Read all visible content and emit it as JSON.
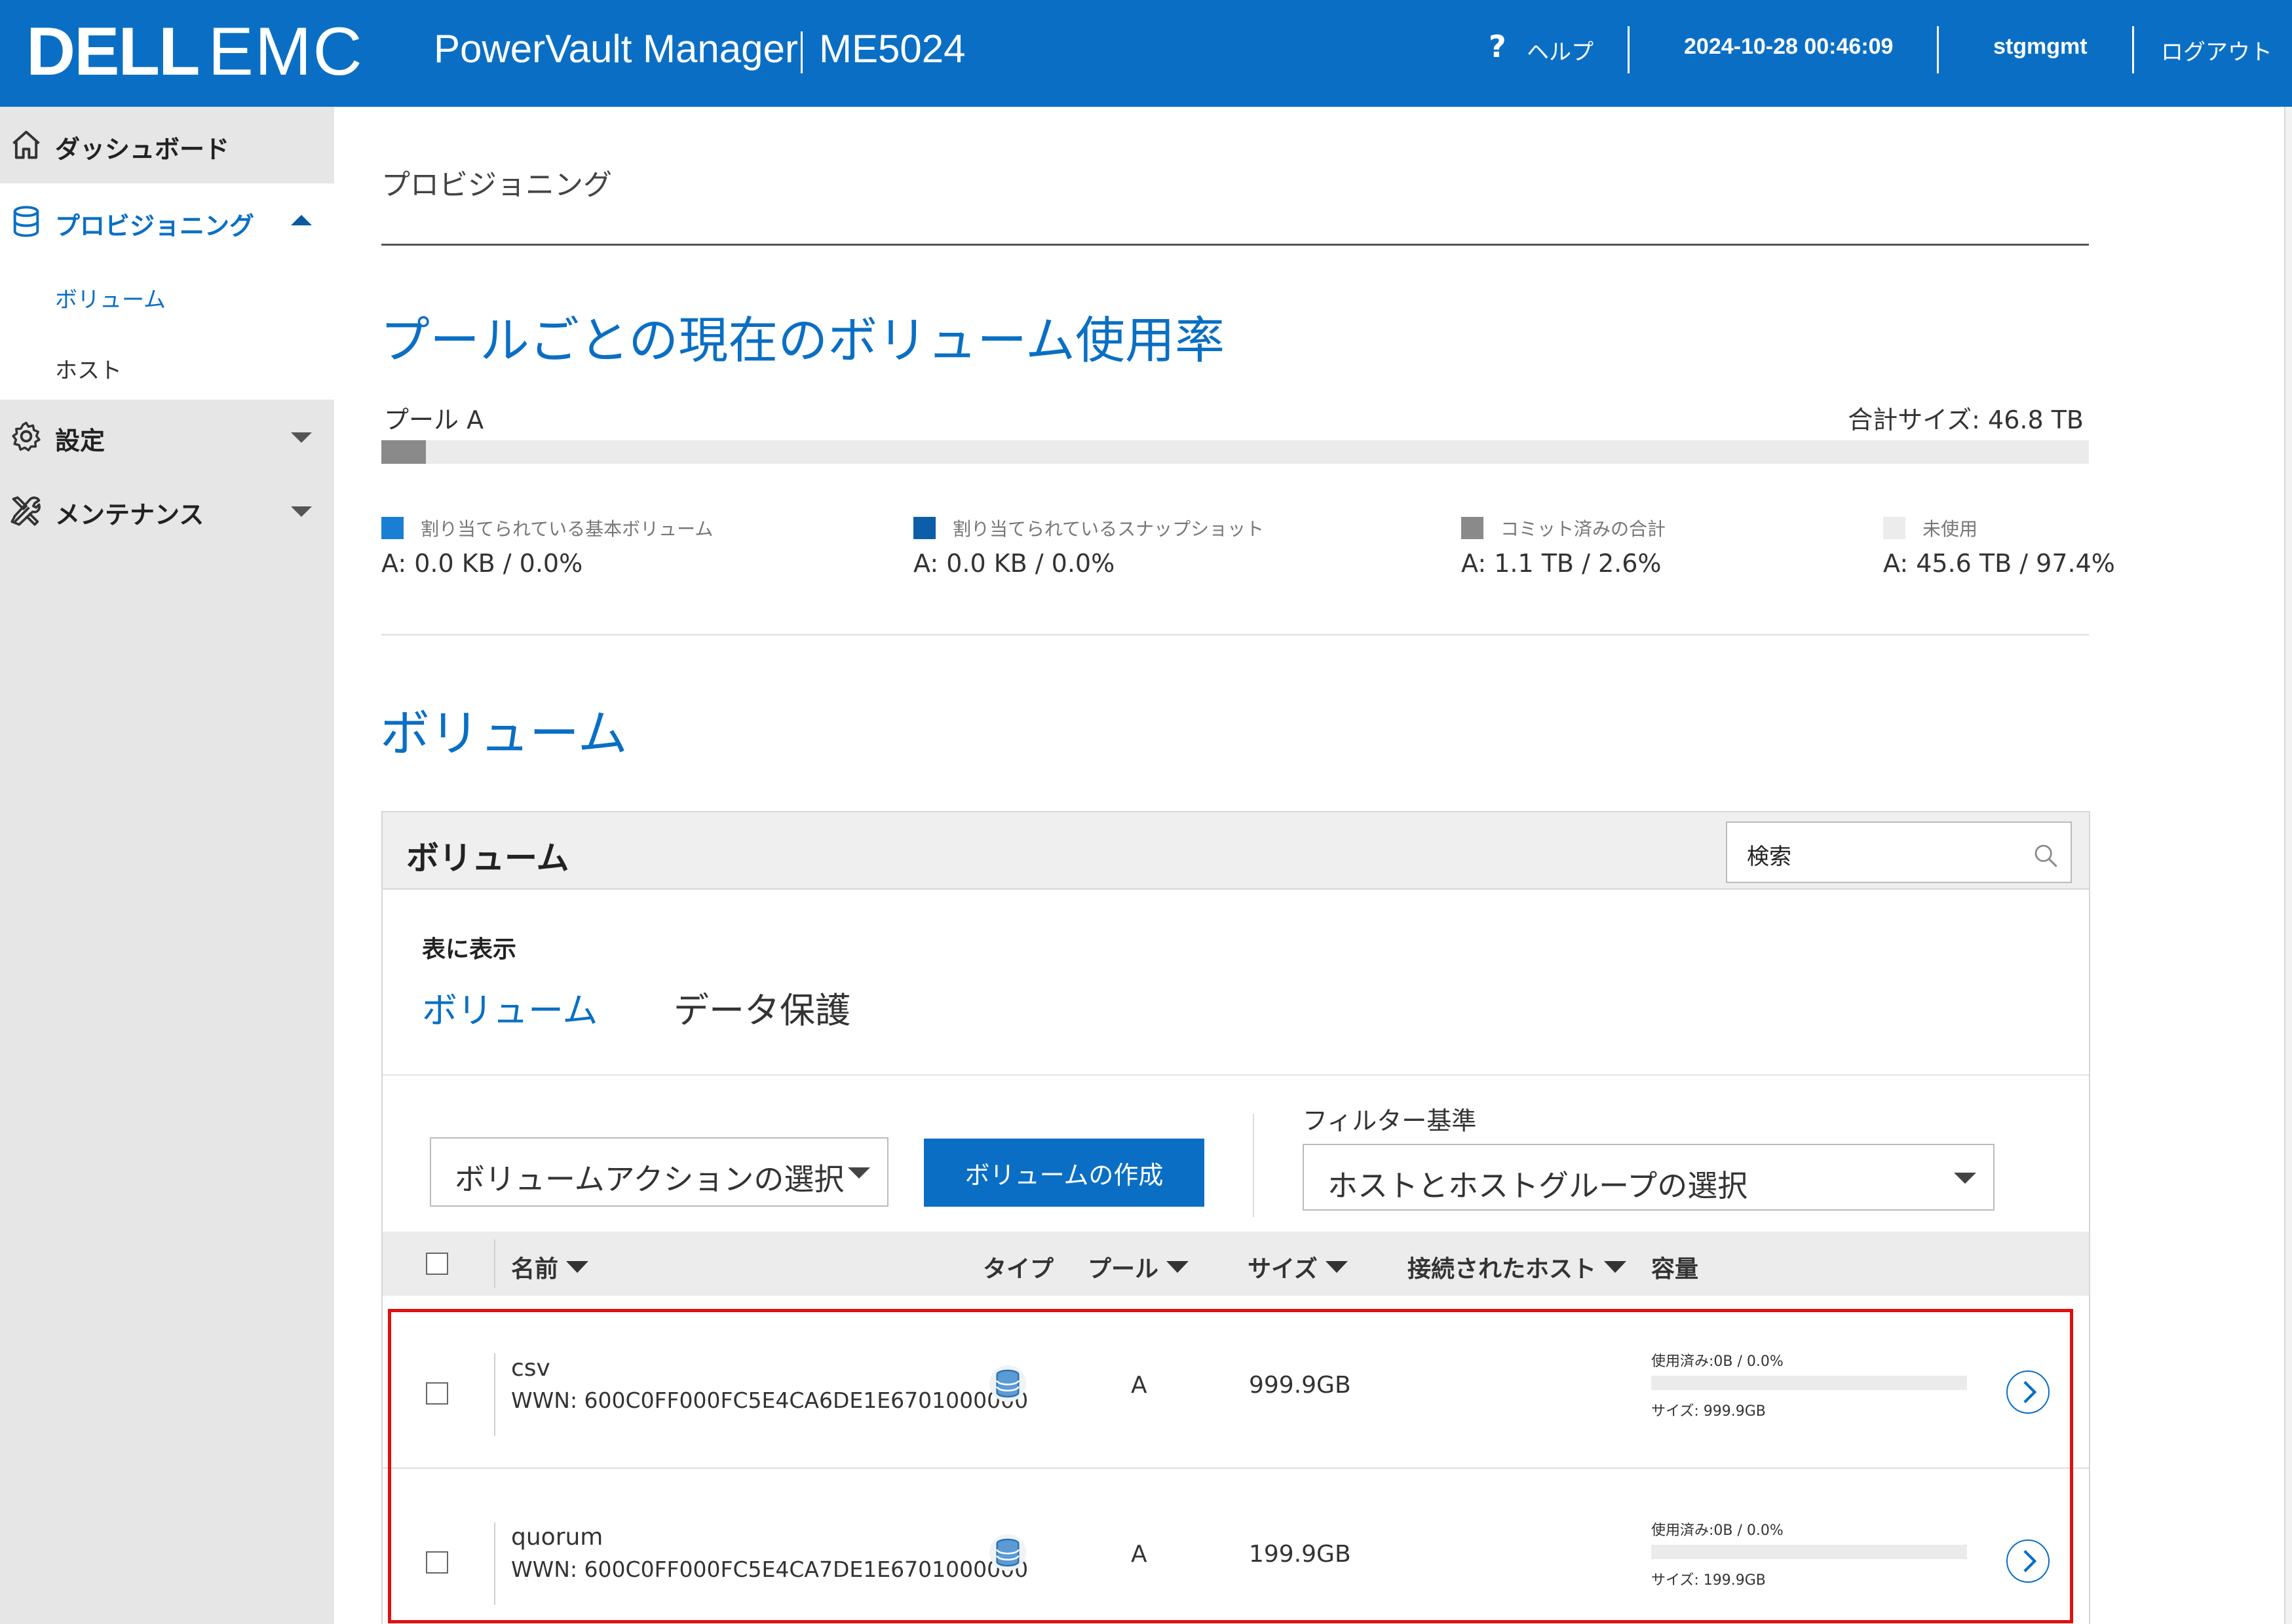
{
  "header": {
    "logo_dell": "DELL",
    "logo_emc": "EMC",
    "app_title": "PowerVault Manager",
    "model": "ME5024",
    "help_icon": "?",
    "help_label": "ヘルプ",
    "datetime": "2024-10-28 00:46:09",
    "user": "stgmgmt",
    "logout_label": "ログアウト"
  },
  "sidebar": {
    "items": [
      {
        "label": "ダッシュボード",
        "icon": "home-icon"
      },
      {
        "label": "プロビジョニング",
        "icon": "database-icon",
        "expanded": true
      },
      {
        "label": "設定",
        "icon": "gear-icon"
      },
      {
        "label": "メンテナンス",
        "icon": "tools-icon"
      }
    ],
    "sub_items": [
      "ボリューム",
      "ホスト"
    ]
  },
  "main": {
    "breadcrumb": "プロビジョニング",
    "usage_title": "プールごとの現在のボリューム使用率",
    "pool": {
      "name": "プール A",
      "total": "合計サイズ: 46.8 TB",
      "used_fraction": 0.026,
      "legend": [
        {
          "label": "割り当てられている基本ボリューム",
          "value": "A: 0.0 KB / 0.0%",
          "color": "#1a7fd4"
        },
        {
          "label": "割り当てられているスナップショット",
          "value": "A: 0.0 KB / 0.0%",
          "color": "#0c5ea8"
        },
        {
          "label": "コミット済みの合計",
          "value": "A: 1.1 TB / 2.6%",
          "color": "#8a8a8a"
        },
        {
          "label": "未使用",
          "value": "A: 45.6 TB / 97.4%",
          "color": "#ececec"
        }
      ]
    },
    "volumes_title": "ボリューム",
    "panel": {
      "title": "ボリューム",
      "search_placeholder": "検索",
      "show_label": "表に表示",
      "tabs": [
        "ボリューム",
        "データ保護"
      ],
      "action_select": "ボリュームアクションの選択",
      "create_button": "ボリュームの作成",
      "filter_label": "フィルター基準",
      "filter_select": "ホストとホストグループの選択",
      "columns": [
        "名前",
        "タイプ",
        "プール",
        "サイズ",
        "接続されたホスト",
        "容量"
      ],
      "rows": [
        {
          "name": "csv",
          "wwn": "WWN: 600C0FF000FC5E4CA6DE1E6701000000",
          "pool": "A",
          "size": "999.9GB",
          "used": "使用済み:0B / 0.0%",
          "cap_size": "サイズ: 999.9GB",
          "used_fraction": 0.0
        },
        {
          "name": "quorum",
          "wwn": "WWN: 600C0FF000FC5E4CA7DE1E6701000000",
          "pool": "A",
          "size": "199.9GB",
          "used": "使用済み:0B / 0.0%",
          "cap_size": "サイズ: 199.9GB",
          "used_fraction": 0.0
        }
      ]
    }
  },
  "colors": {
    "brand": "#0a6fc4",
    "sidebar_bg": "#e6e6e6",
    "highlight": "#e01010"
  }
}
